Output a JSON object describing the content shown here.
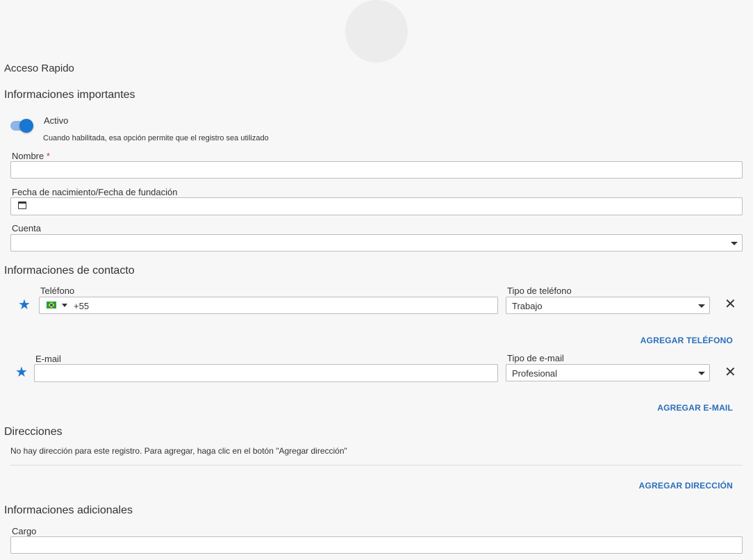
{
  "header": {
    "quick_access": "Acceso Rapido"
  },
  "important": {
    "title": "Informaciones importantes",
    "active_label": "Activo",
    "active_on": true,
    "active_help": "Cuando habilitada, esa opción permite que el registro sea utilizado",
    "name_label": "Nombre",
    "required_mark": "*",
    "name_value": "",
    "birth_label": "Fecha de nacimiento/Fecha de fundación",
    "birth_value": "",
    "account_label": "Cuenta",
    "account_value": ""
  },
  "contact": {
    "title": "Informaciones de contacto",
    "phone_label": "Teléfono",
    "phone_prefix": "+55",
    "phone_type_label": "Tipo de teléfono",
    "phone_type_value": "Trabajo",
    "add_phone": "AGREGAR TELÉFONO",
    "email_label": "E-mail",
    "email_value": "",
    "email_type_label": "Tipo de e-mail",
    "email_type_value": "Profesional",
    "add_email": "AGREGAR E-MAIL"
  },
  "addresses": {
    "title": "Direcciones",
    "empty_text": "No hay dirección para este registro. Para agregar, haga clic en el botón \"Agregar dirección\"",
    "add_address": "AGREGAR DIRECCIÓN"
  },
  "additional": {
    "title": "Informaciones adicionales",
    "cargo_label": "Cargo",
    "cargo_value": ""
  },
  "icons": {
    "star": "★",
    "close": "✕"
  },
  "colors": {
    "accent": "#1976d2",
    "link": "#2a6ebb"
  }
}
